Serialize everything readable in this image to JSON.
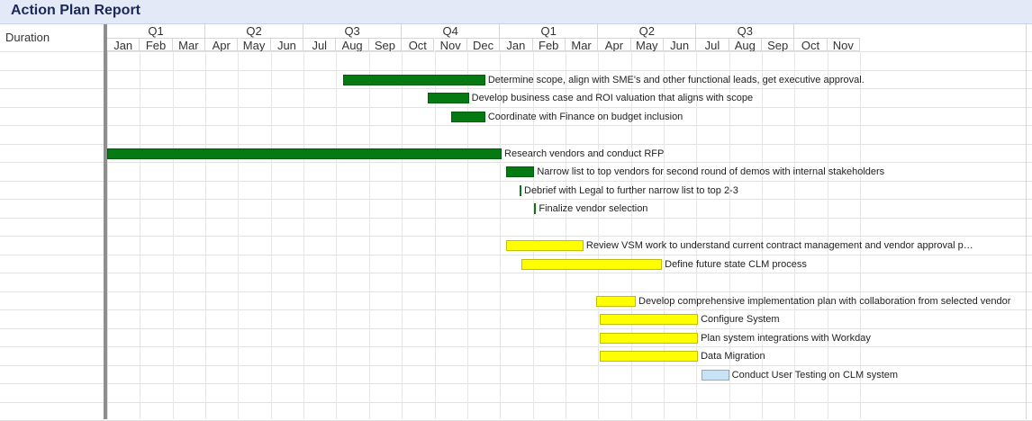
{
  "window": {
    "title": "Action Plan Report"
  },
  "left_panel": {
    "header": "Duration"
  },
  "timeline": {
    "quarters": [
      "Q1",
      "Q2",
      "Q3",
      "Q4",
      "Q1",
      "Q2",
      "Q3"
    ],
    "months": [
      "Jan",
      "Feb",
      "Mar",
      "Apr",
      "May",
      "Jun",
      "Jul",
      "Aug",
      "Sep",
      "Oct",
      "Nov",
      "Dec",
      "Jan",
      "Feb",
      "Mar",
      "Apr",
      "May",
      "Jun",
      "Jul",
      "Aug",
      "Sep",
      "Oct",
      "Nov"
    ]
  },
  "colors": {
    "green": "#057a12",
    "yellow": "#ffff00",
    "lightblue": "#c8e3f5"
  },
  "tasks": [
    {
      "label": "Determine scope, align with SME's and other functional leads, get executive approval.",
      "color": "green",
      "row": 1,
      "start_month": 7.2,
      "end_month": 11.55
    },
    {
      "label": "Develop business case and ROI valuation that aligns with scope",
      "color": "green",
      "row": 2,
      "start_month": 9.8,
      "end_month": 11.05
    },
    {
      "label": "Coordinate with Finance on budget inclusion",
      "color": "green",
      "row": 3,
      "start_month": 10.5,
      "end_month": 11.55
    },
    {
      "label": "Research vendors and conduct RFP",
      "color": "green",
      "row": 5,
      "start_month": 0.0,
      "end_month": 12.05
    },
    {
      "label": "Narrow list to top vendors for second round of demos with internal stakeholders",
      "color": "green",
      "row": 6,
      "start_month": 12.2,
      "end_month": 13.05
    },
    {
      "label": "Debrief with Legal to further narrow list to top 2-3",
      "color": "green",
      "row": 7,
      "start_month": 12.6,
      "end_month": 12.62
    },
    {
      "label": "Finalize vendor selection",
      "color": "green",
      "row": 8,
      "start_month": 13.05,
      "end_month": 13.07
    },
    {
      "label": "Review VSM work to understand current contract management and vendor approval p…",
      "color": "yellow",
      "row": 10,
      "start_month": 12.2,
      "end_month": 14.55
    },
    {
      "label": "Define future state CLM process",
      "color": "yellow",
      "row": 11,
      "start_month": 12.65,
      "end_month": 16.95
    },
    {
      "label": "Develop comprehensive implementation plan with collaboration from selected vendor",
      "color": "yellow",
      "row": 13,
      "start_month": 14.95,
      "end_month": 16.15
    },
    {
      "label": "Configure System",
      "color": "yellow",
      "row": 14,
      "start_month": 15.05,
      "end_month": 18.05
    },
    {
      "label": "Plan system integrations with Workday",
      "color": "yellow",
      "row": 15,
      "start_month": 15.05,
      "end_month": 18.05
    },
    {
      "label": "Data Migration",
      "color": "yellow",
      "row": 16,
      "start_month": 15.05,
      "end_month": 18.05
    },
    {
      "label": "Conduct User Testing on CLM system",
      "color": "lightblue",
      "row": 17,
      "start_month": 18.15,
      "end_month": 19.0
    }
  ]
}
